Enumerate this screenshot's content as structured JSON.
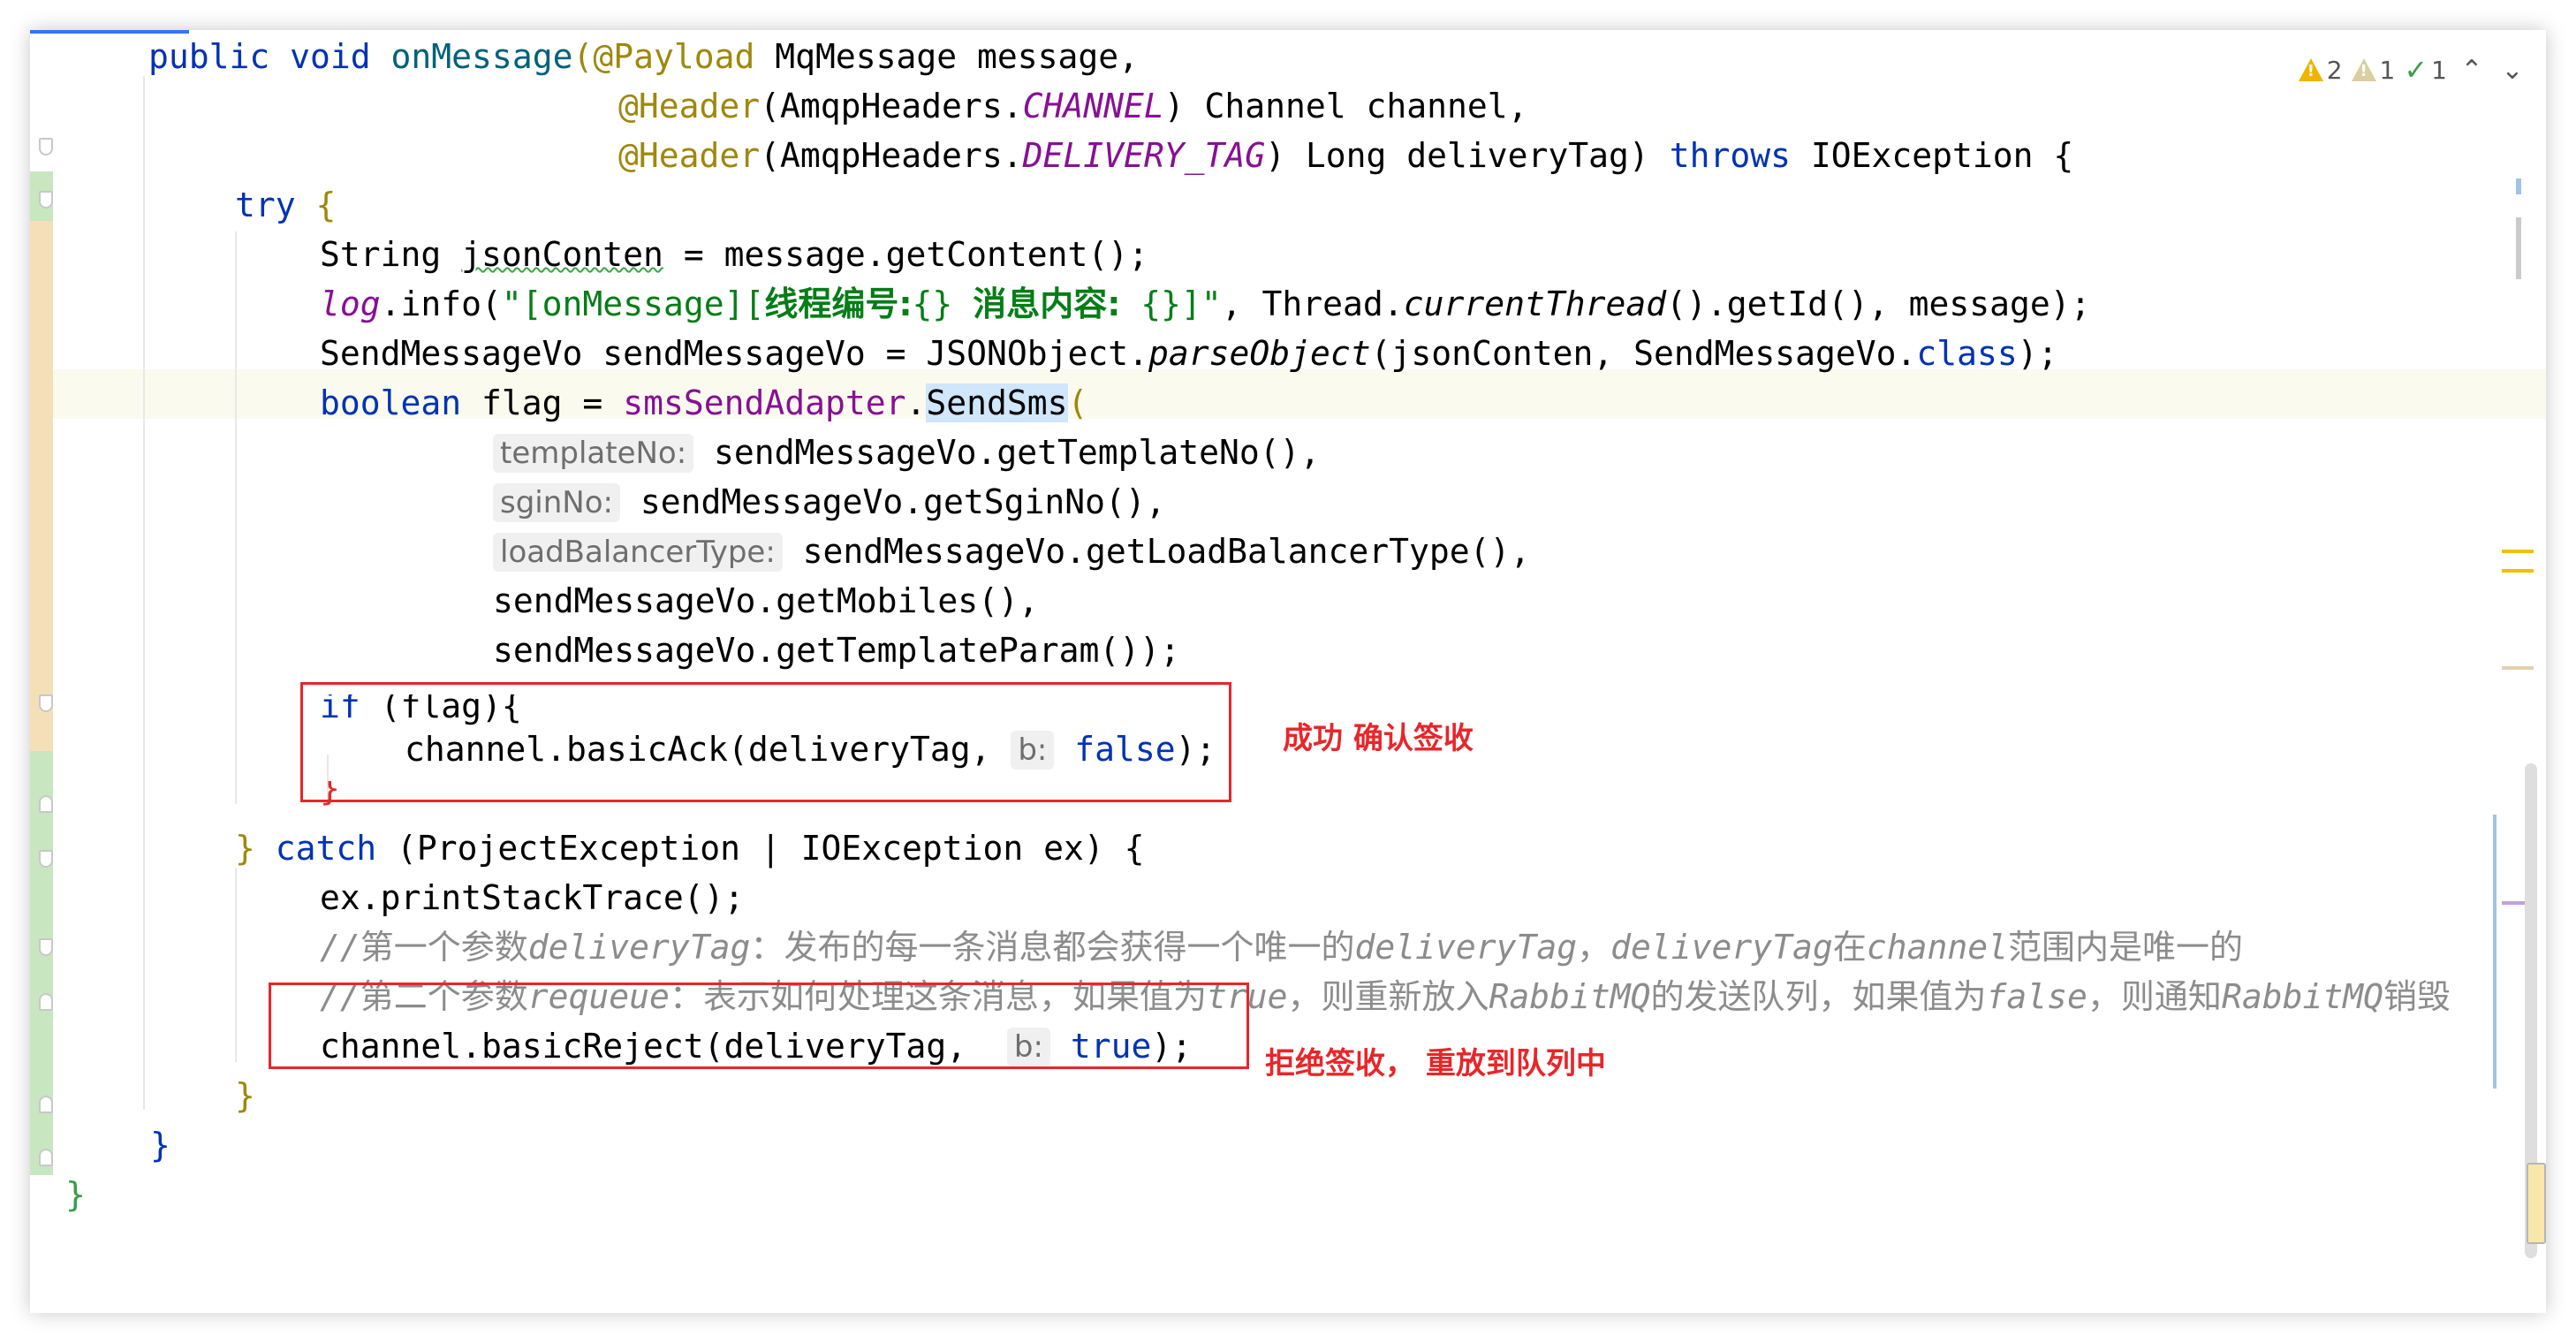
{
  "inspections": {
    "warnings": "2",
    "weak_warnings": "1",
    "typos": "1",
    "prev_icon": "chevron-up-icon",
    "next_icon": "chevron-down-icon"
  },
  "hints": {
    "templateNo": "templateNo:",
    "sginNo": "sginNo:",
    "loadBalancerType": "loadBalancerType:",
    "b_false": "b:",
    "b_true": "b:"
  },
  "annotations": {
    "ack": "成功 确认签收",
    "reject": "拒绝签收， 重放到队列中"
  },
  "code": {
    "l1": {
      "a": "public void ",
      "fn": "onMessage",
      "b": "(",
      "an": "@Payload",
      "c": " MqMessage message,"
    },
    "l2": {
      "an": "@Header",
      "a": "(AmqpHeaders.",
      "const": "CHANNEL",
      "b": ") Channel channel,"
    },
    "l3": {
      "an": "@Header",
      "a": "(AmqpHeaders.",
      "const": "DELIVERY_TAG",
      "b": ") Long deliveryTag) ",
      "kw": "throws",
      "c": " IOException {"
    },
    "l4": {
      "kw": "try",
      "b": " {"
    },
    "l5": {
      "a": "String ",
      "squig": "jsonConten",
      "b": " = message.getContent();"
    },
    "l6": {
      "log": "log",
      "a": ".info(",
      "s1": "\"[onMessage][",
      "s2": "线程编号:",
      "s3": "{} ",
      "s4": "消息内容:",
      "s5": " {}]\"",
      "b": ", Thread.",
      "st": "currentThread",
      "c": "().getId(), message);"
    },
    "l7": {
      "a": "SendMessageVo sendMessageVo = JSONObject.",
      "st": "parseObject",
      "b": "(jsonConten, SendMessageVo.",
      "kw": "class",
      "c": ");"
    },
    "l8": {
      "kw": "boolean",
      "a": " flag = ",
      "field": "smsSendAdapter",
      "b": ".",
      "sel": "SendSms",
      "c": "("
    },
    "l9": {
      "a": " sendMessageVo.getTemplateNo(),"
    },
    "l10": {
      "a": " sendMessageVo.getSginNo(),"
    },
    "l11": {
      "a": " sendMessageVo.getLoadBalancerType(),"
    },
    "l12": {
      "a": "sendMessageVo.getMobiles(),"
    },
    "l13": {
      "a": "sendMessageVo.getTemplateParam());"
    },
    "l14": {
      "kw": "if",
      "a": " (flag){"
    },
    "l15": {
      "a": "channel.basicAck(deliveryTag, ",
      "kw": "false",
      "b": ");"
    },
    "l16": {
      "a": "}"
    },
    "l17": {
      "a": "} ",
      "kw": "catch",
      "b": " (ProjectException | IOException ex) {"
    },
    "l18": {
      "a": "ex.printStackTrace();"
    },
    "l19": {
      "c1": "//",
      "c2": "第一个参数",
      "c3": "deliveryTag",
      "c4": "：发布的每一条消息都会获得一个唯一的",
      "c5": "deliveryTag",
      "c6": "，",
      "c7": "deliveryTag",
      "c8": "在",
      "c9": "channel",
      "c10": "范围内是唯一的"
    },
    "l20": {
      "c1": "//",
      "c2": "第二个参数",
      "c3": "requeue",
      "c4": "：表示如何处理这条消息，如果值为",
      "c5": "true",
      "c6": "，则重新放入",
      "c7": "RabbitMQ",
      "c8": "的发送队列，如果值为",
      "c9": "false",
      "c10": "，则通知",
      "c11": "RabbitMQ",
      "c12": "销毁"
    },
    "l21": {
      "a": "channel.basicReject(deliveryTag, ",
      "kw": "true",
      "b": ");"
    },
    "l22": {
      "a": "}"
    },
    "l23": {
      "a": "}"
    },
    "l24": {
      "a": "}"
    }
  }
}
